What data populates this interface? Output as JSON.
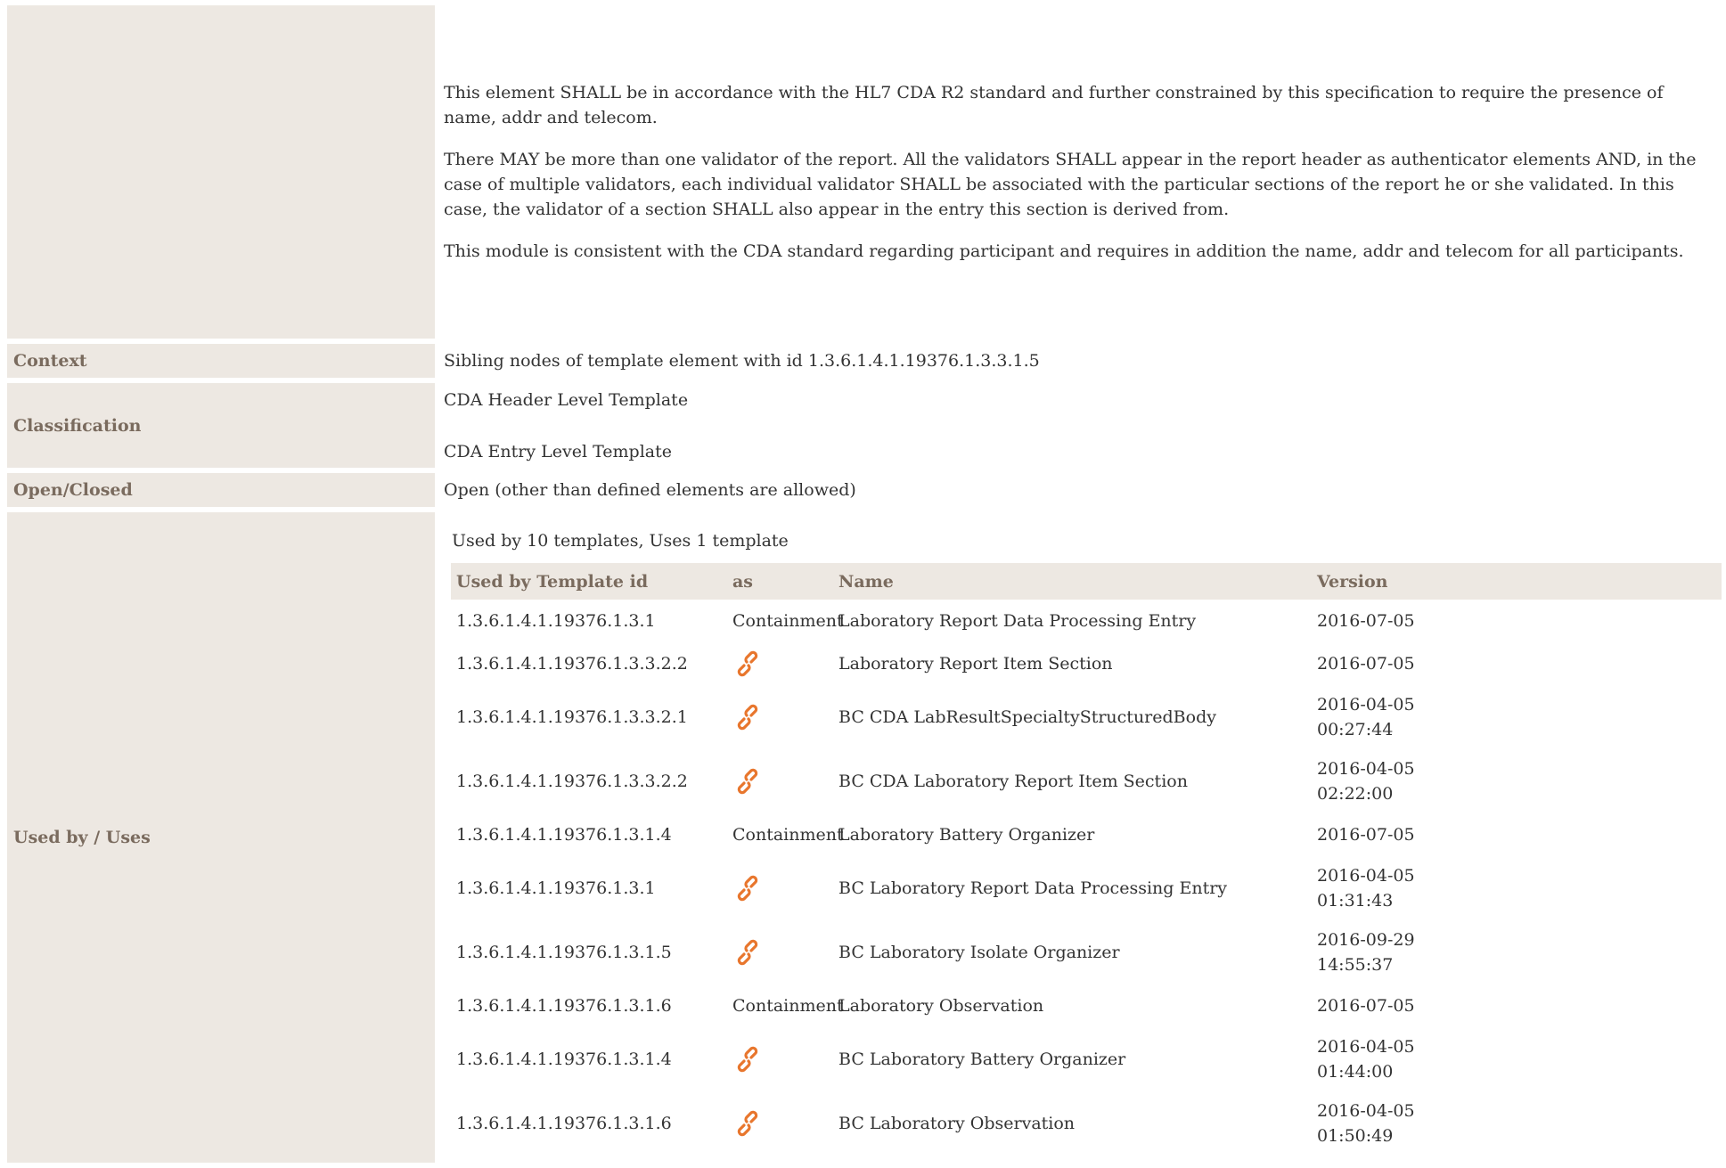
{
  "description": {
    "paragraphs": [
      "This element SHALL be in accordance with the HL7 CDA R2 standard and further constrained by this specification to require the presence of name, addr and telecom.",
      "There MAY be more than one validator of the report. All the validators SHALL appear in the report header as authenticator elements AND, in the case of multiple validators, each individual validator SHALL be associated with the particular sections of the report he or she validated. In this case, the validator of a section SHALL also appear in the entry this section is derived from.",
      "This module is consistent with the CDA standard regarding participant and requires in addition the name, addr and telecom for all participants."
    ]
  },
  "context": {
    "label": "Context",
    "value": "Sibling nodes of template element with id 1.3.6.1.4.1.19376.1.3.3.1.5"
  },
  "classification": {
    "label": "Classification",
    "values": [
      "CDA Header Level Template",
      "CDA Entry Level Template"
    ]
  },
  "open_closed": {
    "label": "Open/Closed",
    "value": "Open (other than defined elements are allowed)"
  },
  "used_by": {
    "label": "Used by / Uses",
    "summary": "Used by 10 templates, Uses 1 template",
    "columns": [
      "Used by Template id",
      "as",
      "Name",
      "Version"
    ],
    "link_icon": "link-icon",
    "accent_color": "#e8762d",
    "rows": [
      {
        "id": "1.3.6.1.4.1.19376.1.3.1",
        "as": "Containment",
        "name": "Laboratory Report Data Processing Entry",
        "version": "2016-07-05"
      },
      {
        "id": "1.3.6.1.4.1.19376.1.3.3.2.2",
        "as": "link",
        "name": "Laboratory Report Item Section",
        "version": "2016-07-05"
      },
      {
        "id": "1.3.6.1.4.1.19376.1.3.3.2.1",
        "as": "link",
        "name": "BC CDA LabResultSpecialtyStructuredBody",
        "version": "2016-04-05 00:27:44"
      },
      {
        "id": "1.3.6.1.4.1.19376.1.3.3.2.2",
        "as": "link",
        "name": "BC CDA Laboratory Report Item Section",
        "version": "2016-04-05 02:22:00"
      },
      {
        "id": "1.3.6.1.4.1.19376.1.3.1.4",
        "as": "Containment",
        "name": "Laboratory Battery Organizer",
        "version": "2016-07-05"
      },
      {
        "id": "1.3.6.1.4.1.19376.1.3.1",
        "as": "link",
        "name": "BC Laboratory Report Data Processing Entry",
        "version": "2016-04-05 01:31:43"
      },
      {
        "id": "1.3.6.1.4.1.19376.1.3.1.5",
        "as": "link",
        "name": "BC Laboratory Isolate Organizer",
        "version": "2016-09-29 14:55:37"
      },
      {
        "id": "1.3.6.1.4.1.19376.1.3.1.6",
        "as": "Containment",
        "name": "Laboratory Observation",
        "version": "2016-07-05"
      },
      {
        "id": "1.3.6.1.4.1.19376.1.3.1.4",
        "as": "link",
        "name": "BC Laboratory Battery Organizer",
        "version": "2016-04-05 01:44:00"
      },
      {
        "id": "1.3.6.1.4.1.19376.1.3.1.6",
        "as": "link",
        "name": "BC Laboratory Observation",
        "version": "2016-04-05 01:50:49"
      }
    ]
  }
}
